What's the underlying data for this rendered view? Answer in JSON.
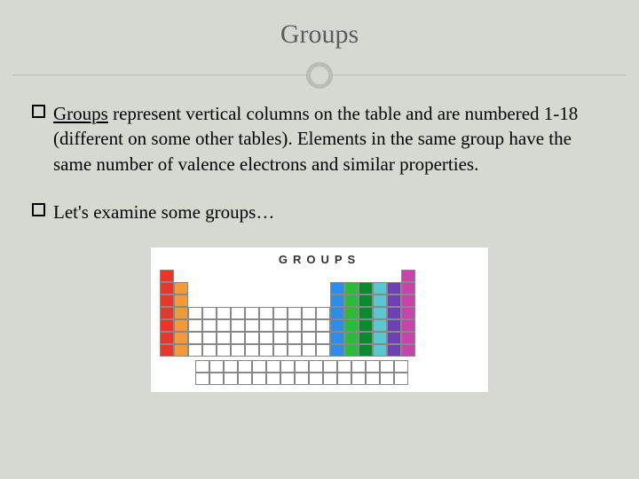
{
  "title": "Groups",
  "bullets": [
    {
      "lead": "Groups",
      "rest": " represent vertical columns on the table and are numbered 1-18 (different on some other tables). Elements in the same group have the same number of valence electrons and similar properties."
    },
    {
      "lead": "",
      "rest": "Let's examine some groups…"
    }
  ],
  "figure": {
    "label": "GROUPS"
  },
  "chart_data": {
    "type": "table",
    "title": "GROUPS",
    "description": "Periodic table outline with groups 1, 2, 13-18 highlighted in color; transition and f-block shown uncolored.",
    "groups_total": 18,
    "highlighted_groups": [
      {
        "group": 1,
        "color": "#e8362a",
        "periods": [
          1,
          2,
          3,
          4,
          5,
          6,
          7
        ]
      },
      {
        "group": 2,
        "color": "#f29a3a",
        "periods": [
          2,
          3,
          4,
          5,
          6,
          7
        ]
      },
      {
        "group": 13,
        "color": "#2f8de8",
        "periods": [
          2,
          3,
          4,
          5,
          6,
          7
        ]
      },
      {
        "group": 14,
        "color": "#2bbb3a",
        "periods": [
          2,
          3,
          4,
          5,
          6,
          7
        ]
      },
      {
        "group": 15,
        "color": "#0a8a2e",
        "periods": [
          2,
          3,
          4,
          5,
          6,
          7
        ]
      },
      {
        "group": 16,
        "color": "#5bc6d0",
        "periods": [
          2,
          3,
          4,
          5,
          6,
          7
        ]
      },
      {
        "group": 17,
        "color": "#6f3fb5",
        "periods": [
          2,
          3,
          4,
          5,
          6,
          7
        ]
      },
      {
        "group": 18,
        "color": "#c742ad",
        "periods": [
          1,
          2,
          3,
          4,
          5,
          6,
          7
        ]
      }
    ],
    "transition_block": {
      "groups": [
        3,
        4,
        5,
        6,
        7,
        8,
        9,
        10,
        11,
        12
      ],
      "periods": [
        4,
        5,
        6,
        7
      ],
      "color": "#ffffff"
    },
    "f_block": {
      "rows": 2,
      "cols": 15,
      "color": "#ffffff"
    }
  }
}
